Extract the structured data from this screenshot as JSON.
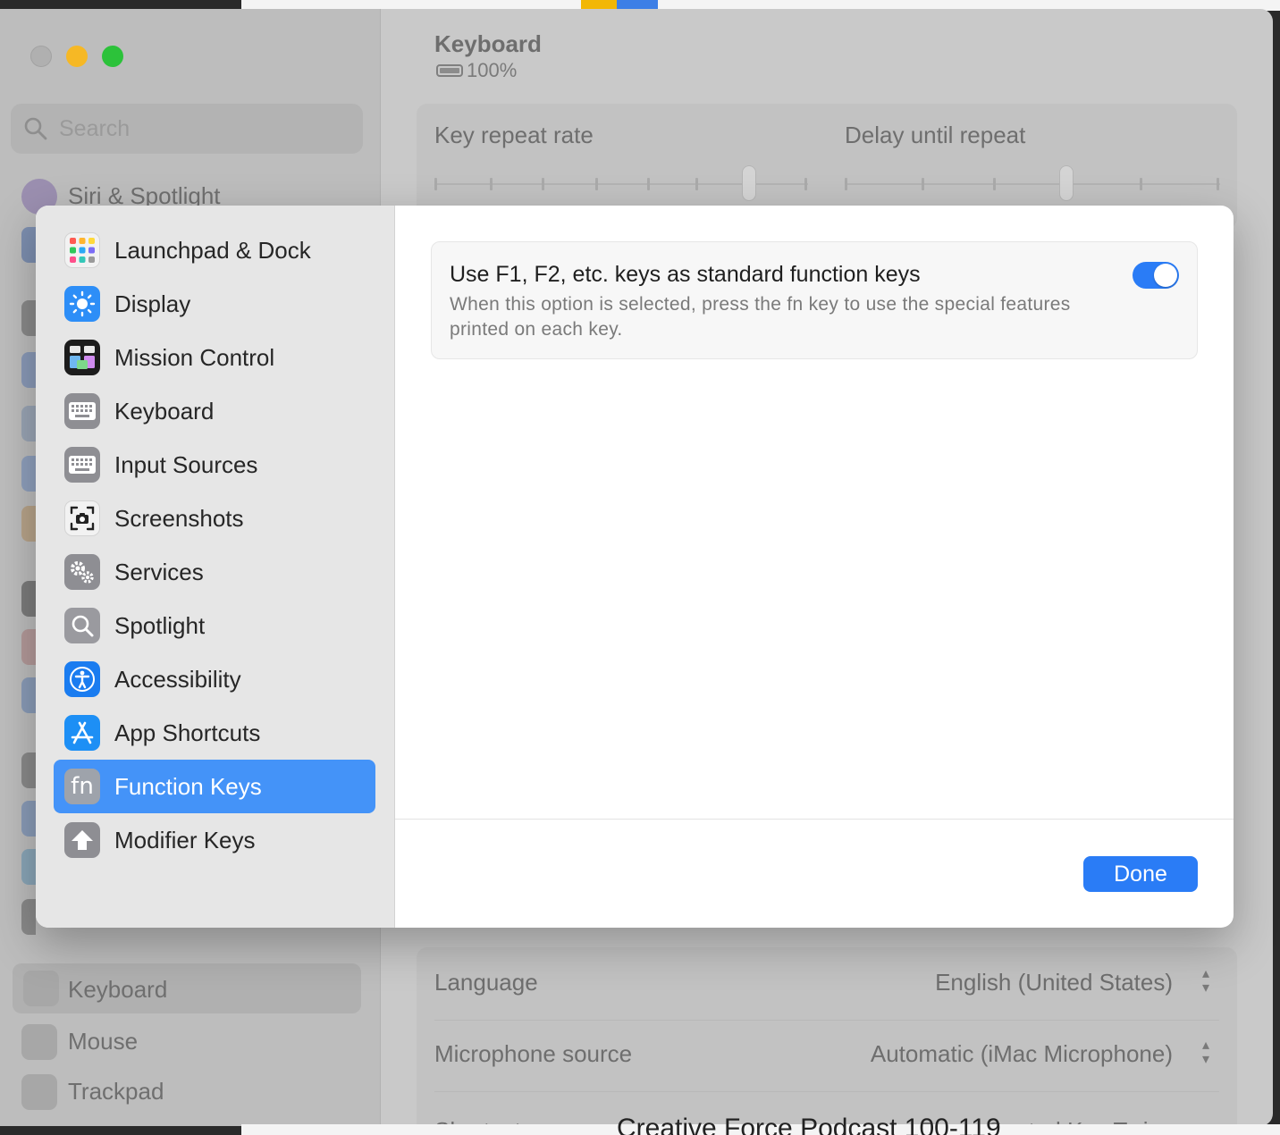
{
  "colors": {
    "accent": "#2a7cf6",
    "selection": "#4493f8",
    "traffic_min": "#f6b825",
    "traffic_max": "#2cc23a"
  },
  "window": {
    "search_placeholder": "Search",
    "sidebar_items": [
      {
        "label": "Siri & Spotlight",
        "icon": "siri-icon"
      },
      {
        "label": "Keyboard",
        "icon": "keyboard-icon"
      },
      {
        "label": "Mouse",
        "icon": "mouse-icon"
      },
      {
        "label": "Trackpad",
        "icon": "trackpad-icon"
      }
    ],
    "title": "Keyboard",
    "battery": "100%",
    "key_repeat_label": "Key repeat rate",
    "delay_label": "Delay until repeat",
    "rows": [
      {
        "key": "Language",
        "value": "English (United States)"
      },
      {
        "key": "Microphone source",
        "value": "Automatic (iMac Microphone)"
      }
    ],
    "partial_row_key": "Shortcut",
    "partial_row_value": "Press Control Key Twice",
    "background_text": "Creative Force Podcast 100-119"
  },
  "sheet": {
    "nav": [
      {
        "label": "Launchpad & Dock",
        "icon": "launchpad-icon"
      },
      {
        "label": "Display",
        "icon": "display-brightness-icon"
      },
      {
        "label": "Mission Control",
        "icon": "mission-control-icon"
      },
      {
        "label": "Keyboard",
        "icon": "keyboard-icon"
      },
      {
        "label": "Input Sources",
        "icon": "input-sources-icon"
      },
      {
        "label": "Screenshots",
        "icon": "screenshot-icon"
      },
      {
        "label": "Services",
        "icon": "services-gear-icon"
      },
      {
        "label": "Spotlight",
        "icon": "spotlight-search-icon"
      },
      {
        "label": "Accessibility",
        "icon": "accessibility-icon"
      },
      {
        "label": "App Shortcuts",
        "icon": "app-store-icon"
      },
      {
        "label": "Function Keys",
        "icon": "fn-icon",
        "icon_text": "fn",
        "selected": true
      },
      {
        "label": "Modifier Keys",
        "icon": "modifier-arrow-icon"
      }
    ],
    "option": {
      "title": "Use F1, F2, etc. keys as standard function keys",
      "description": "When this option is selected, press the fn key to use the special features printed on each key.",
      "enabled": true
    },
    "done_label": "Done"
  }
}
